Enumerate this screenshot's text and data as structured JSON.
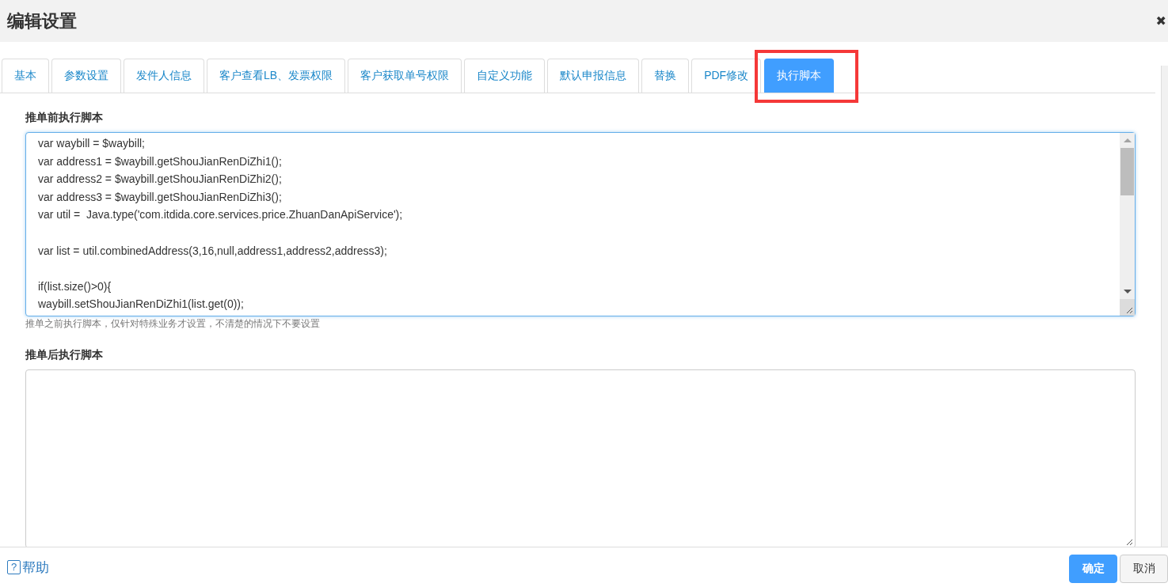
{
  "window": {
    "title": "编辑设置",
    "close": "✖"
  },
  "tabs": [
    {
      "label": "基本",
      "selected": false,
      "highlighted": false
    },
    {
      "label": "参数设置",
      "selected": false,
      "highlighted": false
    },
    {
      "label": "发件人信息",
      "selected": false,
      "highlighted": false
    },
    {
      "label": "客户查看LB、发票权限",
      "selected": false,
      "highlighted": false
    },
    {
      "label": "客户获取单号权限",
      "selected": false,
      "highlighted": false
    },
    {
      "label": "自定义功能",
      "selected": false,
      "highlighted": false
    },
    {
      "label": "默认申报信息",
      "selected": false,
      "highlighted": false
    },
    {
      "label": "替换",
      "selected": false,
      "highlighted": false
    },
    {
      "label": "PDF修改",
      "selected": false,
      "highlighted": false
    },
    {
      "label": "执行脚本",
      "selected": true,
      "highlighted": true
    }
  ],
  "fields": [
    {
      "label": "推单前执行脚本",
      "value": "var waybill = $waybill;\nvar address1 = $waybill.getShouJianRenDiZhi1();\nvar address2 = $waybill.getShouJianRenDiZhi2();\nvar address3 = $waybill.getShouJianRenDiZhi3();\nvar util =  Java.type('com.itdida.core.services.price.ZhuanDanApiService');\n\nvar list = util.combinedAddress(3,16,null,address1,address2,address3);\n\nif(list.size()>0){\nwaybill.setShouJianRenDiZhi1(list.get(0));",
      "focused": true,
      "hint": "推单之前执行脚本，仅针对特殊业务才设置，不清楚的情况下不要设置"
    },
    {
      "label": "推单后执行脚本",
      "focused": false
    }
  ],
  "footer": {
    "help": "帮助",
    "help_icon": "?",
    "buttons": [
      {
        "label": "确定",
        "kind": "primary"
      },
      {
        "label": "取消",
        "kind": "default"
      }
    ]
  }
}
